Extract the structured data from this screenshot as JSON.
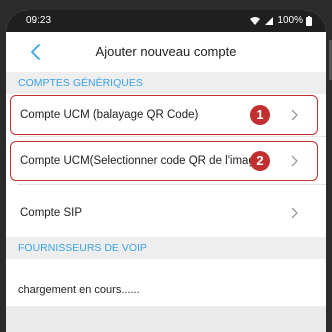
{
  "status_bar": {
    "time": "09:23",
    "battery": "100%",
    "icons": [
      "wifi-icon",
      "signal-icon",
      "battery-icon"
    ]
  },
  "header": {
    "title": "Ajouter nouveau compte",
    "back_icon": "chevron-left-icon"
  },
  "sections": [
    {
      "title": "COMPTES GÉNÉRIQUES",
      "items": [
        {
          "label": "Compte UCM (balayage QR Code)",
          "marker": "1"
        },
        {
          "label": "Compte UCM(Selectionner code QR de l'image)",
          "marker": "2"
        },
        {
          "label": "Compte SIP"
        }
      ]
    },
    {
      "title": "FOURNISSEURS DE VOIP",
      "status_text": "chargement en cours......"
    }
  ],
  "colors": {
    "accent": "#3aa3e3",
    "annotation": "#c22f2f",
    "section_background": "#eeeeee"
  }
}
